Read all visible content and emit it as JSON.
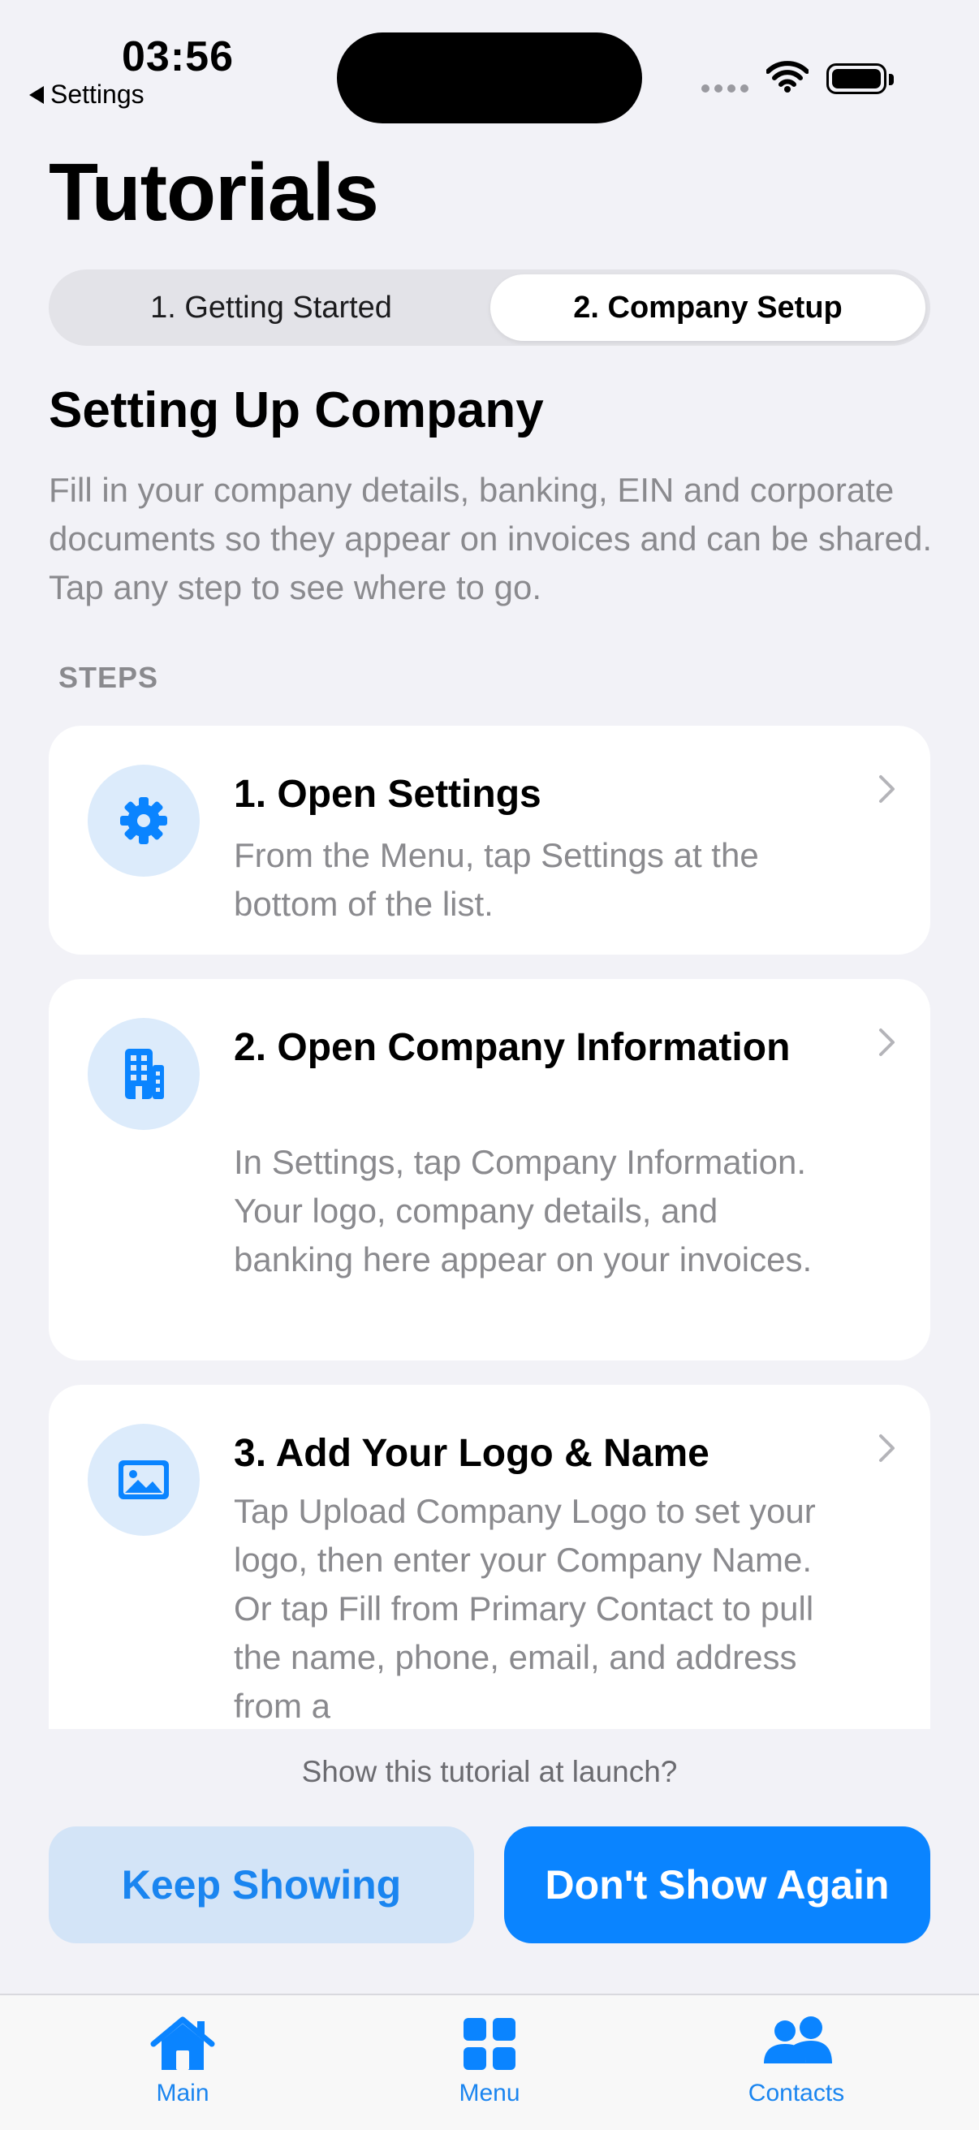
{
  "status_bar": {
    "time": "03:56",
    "back_app": "Settings"
  },
  "page_title": "Tutorials",
  "segments": [
    "1. Getting Started",
    "2. Company Setup"
  ],
  "selected_segment": "2. Company Setup",
  "section": {
    "title": "Setting Up Company",
    "intro": "Fill in your company details, banking, EIN and corporate documents so they appear on invoices and can be shared. Tap any step to see where to go.",
    "steps_label": "STEPS"
  },
  "steps": [
    {
      "title": "1. Open Settings",
      "description": "From the Menu, tap Settings at the bottom of the list.",
      "icon": "gear-icon"
    },
    {
      "title": "2. Open Company Information",
      "description": "In Settings, tap Company Information. Your logo, company details, and banking here appear on your invoices.",
      "icon": "building-icon"
    },
    {
      "title": "3. Add Your Logo & Name",
      "description": "Tap Upload Company Logo to set your logo, then enter your Company Name. Or tap Fill from Primary Contact to pull the name, phone, email, and address from a",
      "icon": "photo-icon"
    }
  ],
  "launch_prompt": "Show this tutorial at launch?",
  "buttons": {
    "keep": "Keep Showing",
    "dont": "Don't Show Again"
  },
  "tabbar": [
    {
      "label": "Main",
      "icon": "house-icon"
    },
    {
      "label": "Menu",
      "icon": "grid-icon"
    },
    {
      "label": "Contacts",
      "icon": "people-icon"
    }
  ],
  "colors": {
    "accent": "#0a84ff",
    "background": "#f2f2f7",
    "icon_bg": "#dcebfb",
    "secondary_text": "#8a8a8e"
  }
}
